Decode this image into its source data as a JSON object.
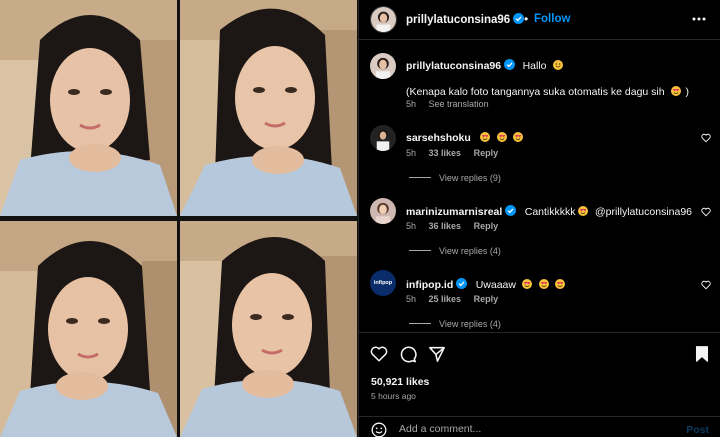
{
  "post": {
    "username": "prillylatuconsina96",
    "follow_label": "Follow",
    "separator": "•"
  },
  "caption": {
    "username": "prillylatuconsina96",
    "line1": "Hallo",
    "line2": "(Kenapa kalo foto tangannya suka otomatis ke dagu sih",
    "line2_end": ")",
    "time": "5h",
    "see_translation": "See translation"
  },
  "comments": [
    {
      "username": "sarsehshoku",
      "text": "",
      "emoji_count": 3,
      "time": "5h",
      "likes": "33 likes",
      "reply": "Reply",
      "view_replies": "View replies (9)"
    },
    {
      "username": "marinizumarnisreal",
      "text": "Cantikkkkk",
      "mention": "@prillylatuconsina96",
      "emoji_count": 1,
      "time": "5h",
      "likes": "36 likes",
      "reply": "Reply",
      "view_replies": "View replies (4)"
    },
    {
      "username": "infipop.id",
      "text": "Uwaaaw",
      "emoji_count": 3,
      "time": "5h",
      "likes": "25 likes",
      "reply": "Reply",
      "view_replies": "View replies (4)",
      "avatar_text": "infipop"
    }
  ],
  "stats": {
    "likes": "50,921 likes",
    "time_ago": "5 hours ago"
  },
  "composer": {
    "placeholder": "Add a comment...",
    "post_label": "Post"
  },
  "colors": {
    "accent": "#0095f6",
    "verified": "#0095f6",
    "emoji": "#e0245e",
    "muted": "#a8a8a8",
    "border": "#262626"
  },
  "icons": [
    "more-options-icon",
    "verified-badge-icon",
    "heart-icon",
    "comment-icon",
    "share-icon",
    "bookmark-icon",
    "smile-icon",
    "heart-eyes-emoji",
    "smile-emoji"
  ]
}
